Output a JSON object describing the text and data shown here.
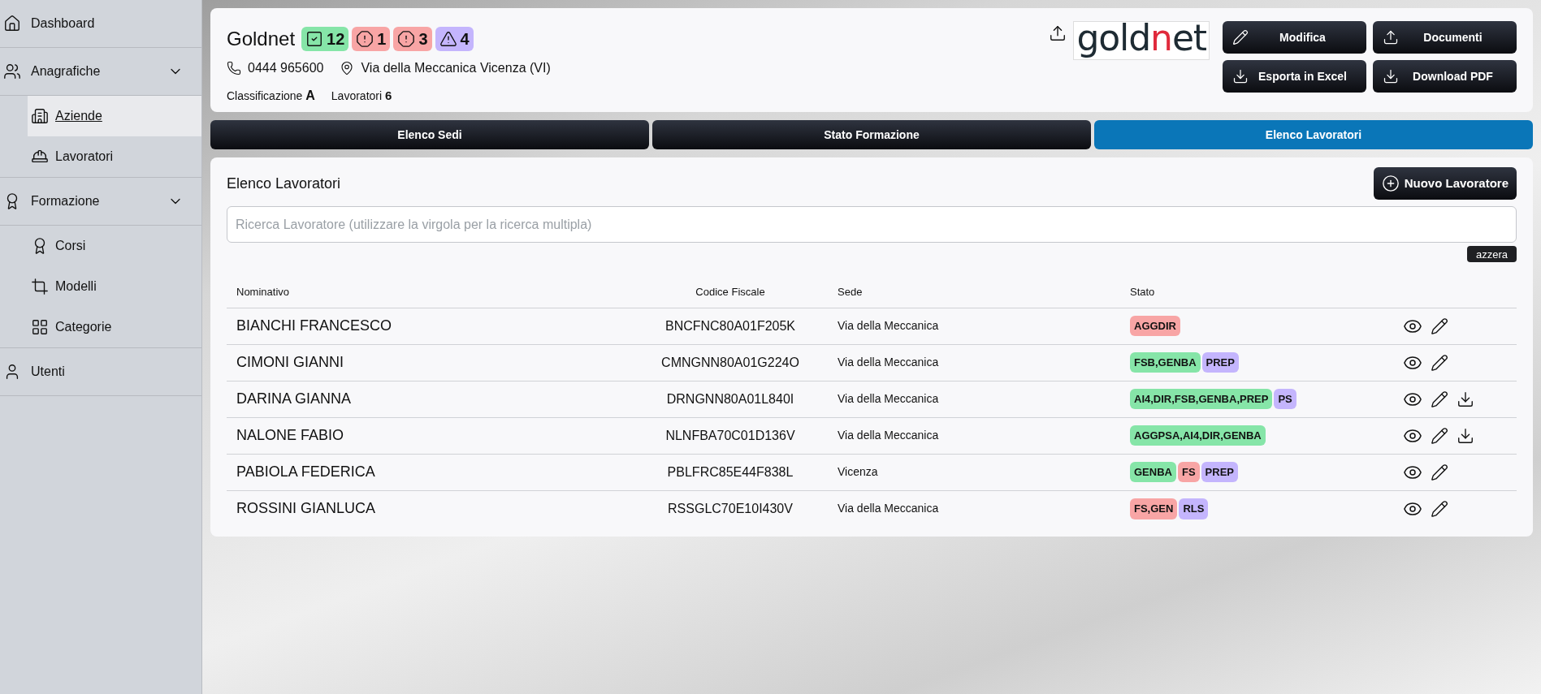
{
  "sidebar": {
    "items": [
      {
        "label": "Dashboard",
        "kind": "home",
        "selected": false
      },
      {
        "label": "Anagrafiche",
        "kind": "users",
        "expanded": true,
        "children": [
          {
            "label": "Aziende",
            "kind": "building",
            "selected": true
          },
          {
            "label": "Lavoratori",
            "kind": "helmet",
            "selected": false
          }
        ]
      },
      {
        "label": "Formazione",
        "kind": "award",
        "expanded": true,
        "children": [
          {
            "label": "Corsi",
            "kind": "award",
            "selected": false
          },
          {
            "label": "Modelli",
            "kind": "crop",
            "selected": false
          },
          {
            "label": "Categorie",
            "kind": "grid",
            "selected": false
          }
        ]
      },
      {
        "label": "Utenti",
        "kind": "user",
        "selected": false
      }
    ]
  },
  "company": {
    "name": "Goldnet",
    "badges": [
      {
        "kind": "check",
        "count": "12",
        "color": "#86e5a8"
      },
      {
        "kind": "octagon",
        "count": "1",
        "color": "#f8a5a5"
      },
      {
        "kind": "octagon",
        "count": "3",
        "color": "#f8a5a5"
      },
      {
        "kind": "triangle",
        "count": "4",
        "color": "#c4b5fd"
      }
    ],
    "phone": "0444 965600",
    "address": "Via della Meccanica Vicenza (VI)",
    "classification_label": "Classificazione",
    "classification": "A",
    "workers_label": "Lavoratori",
    "workers": "6",
    "logo": [
      {
        "text": "gold",
        "color": "#1e2b33"
      },
      {
        "text": "n",
        "color": "#e02a3c"
      },
      {
        "text": "et",
        "color": "#1e2b33"
      }
    ],
    "buttons": [
      {
        "label": "Modifica",
        "kind": "pencil"
      },
      {
        "label": "Documenti",
        "kind": "upload"
      },
      {
        "label": "Esporta in Excel",
        "kind": "download"
      },
      {
        "label": "Download PDF",
        "kind": "download"
      }
    ]
  },
  "tabs": [
    {
      "label": "Elenco Sedi",
      "selected": false
    },
    {
      "label": "Stato Formazione",
      "selected": false
    },
    {
      "label": "Elenco Lavoratori",
      "selected": true
    }
  ],
  "list": {
    "title": "Elenco Lavoratori",
    "new_button": "Nuovo Lavoratore",
    "search": {
      "placeholder": "Ricerca Lavoratore (utilizzare la virgola per la ricerca multipla)"
    },
    "reset_button": "azzera",
    "columns": [
      "Nominativo",
      "Codice Fiscale",
      "Sede",
      "Stato"
    ],
    "rows": [
      {
        "name": "BIANCHI FRANCESCO",
        "tax_code": "BNCFNC80A01F205K",
        "site": "Via della Meccanica",
        "tags": [
          {
            "text": "AGGDIR",
            "color": "#f8a5a5"
          }
        ],
        "download": false
      },
      {
        "name": "CIMONI GIANNI",
        "tax_code": "CMNGNN80A01G224O",
        "site": "Via della Meccanica",
        "tags": [
          {
            "text": "FSB,GENBA",
            "color": "#86e5a8"
          },
          {
            "text": "PREP",
            "color": "#c4b5fd"
          }
        ],
        "download": false
      },
      {
        "name": "DARINA GIANNA",
        "tax_code": "DRNGNN80A01L840I",
        "site": "Via della Meccanica",
        "tags": [
          {
            "text": "AI4,DIR,FSB,GENBA,PREP",
            "color": "#86e5a8"
          },
          {
            "text": "PS",
            "color": "#c4b5fd"
          }
        ],
        "download": true
      },
      {
        "name": "NALONE FABIO",
        "tax_code": "NLNFBA70C01D136V",
        "site": "Via della Meccanica",
        "tags": [
          {
            "text": "AGGPSA,AI4,DIR,GENBA",
            "color": "#86e5a8"
          }
        ],
        "download": true
      },
      {
        "name": "PABIOLA FEDERICA",
        "tax_code": "PBLFRC85E44F838L",
        "site": "Vicenza",
        "tags": [
          {
            "text": "GENBA",
            "color": "#86e5a8"
          },
          {
            "text": "FS",
            "color": "#f8a5a5"
          },
          {
            "text": "PREP",
            "color": "#c4b5fd"
          }
        ],
        "download": false
      },
      {
        "name": "ROSSINI GIANLUCA",
        "tax_code": "RSSGLC70E10I430V",
        "site": "Via della Meccanica",
        "tags": [
          {
            "text": "FS,GEN",
            "color": "#f8a5a5"
          },
          {
            "text": "RLS",
            "color": "#c4b5fd"
          }
        ],
        "download": false
      }
    ]
  }
}
